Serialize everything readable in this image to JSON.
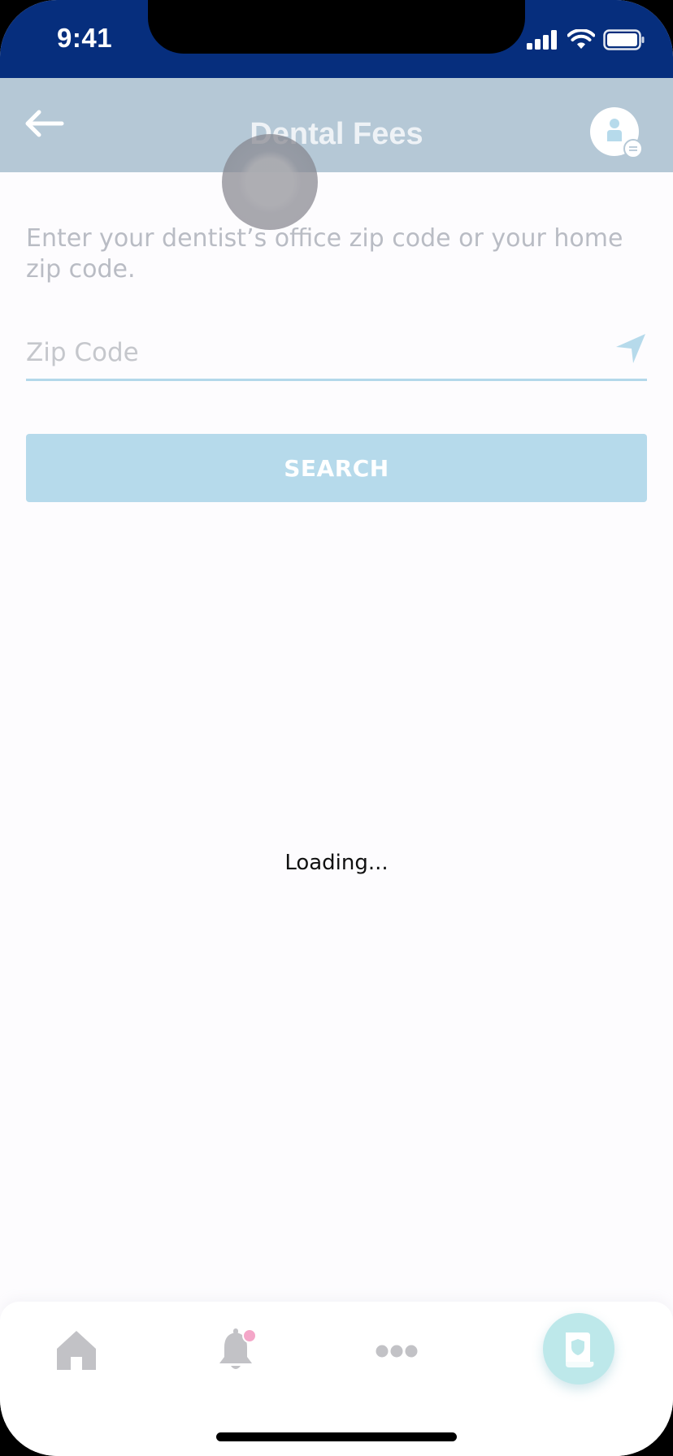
{
  "status_bar": {
    "time": "9:41"
  },
  "header": {
    "title": "Dental Fees",
    "back_icon": "arrow-left-icon",
    "avatar_icon": "member-card-icon"
  },
  "form": {
    "instructions": "Enter your dentist’s office zip code or your home zip code.",
    "zip_placeholder": "Zip Code",
    "zip_value": "",
    "location_icon": "location-arrow-icon",
    "search_label": "SEARCH"
  },
  "loading_text": "Loading...",
  "tab_bar": {
    "items": [
      {
        "icon": "home-icon",
        "active": false
      },
      {
        "icon": "bell-icon",
        "active": false,
        "badge": true
      },
      {
        "icon": "more-dots-icon",
        "active": false
      },
      {
        "icon": "claims-shield-icon",
        "active": true
      }
    ]
  },
  "colors": {
    "status_bar": "#062e7d",
    "header_overlay": "#b5c8d6",
    "accent_light": "#b6daeb",
    "badge": "#f4a6c8",
    "active_tab": "#bde8ea"
  }
}
